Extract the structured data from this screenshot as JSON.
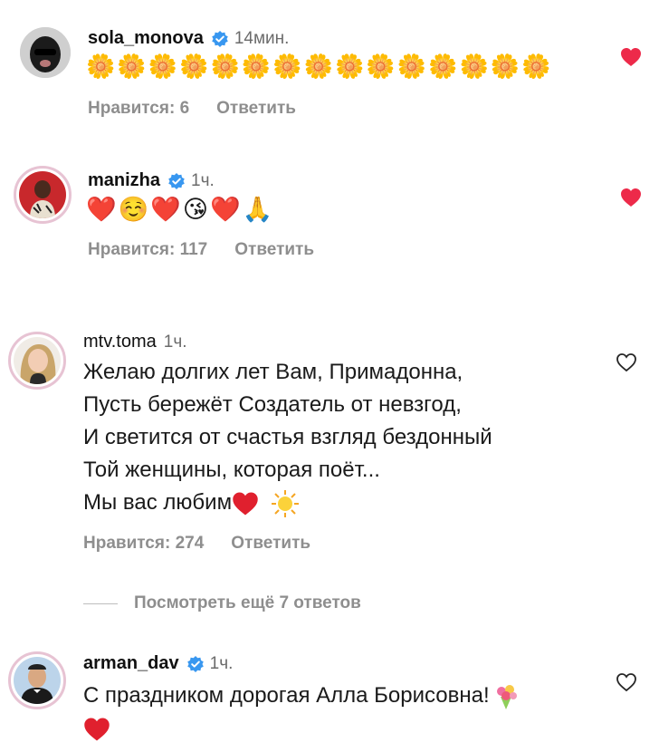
{
  "comments": [
    {
      "username": "sola_monova",
      "verified": true,
      "time": "14мин.",
      "emoji_text": "🌼🌼🌼🌼🌼🌼🌼🌼🌼🌼🌼🌼🌼🌼🌼",
      "likes_label": "Нравится: 6",
      "reply_label": "Ответить",
      "liked": true
    },
    {
      "username": "manizha",
      "verified": true,
      "time": "1ч.",
      "emoji_text": "❤️☺️❤️😘❤️🙏",
      "likes_label": "Нравится: 117",
      "reply_label": "Ответить",
      "liked": true
    },
    {
      "username": "mtv.toma",
      "verified": false,
      "time": "1ч.",
      "lines": [
        "Желаю долгих лет Вам, Примадонна,",
        "Пусть бережёт Создатель от невзгод,",
        "И светится от счастья взгляд бездонный",
        "Той женщины, которая поёт...",
        "Мы вас любим"
      ],
      "likes_label": "Нравится: 274",
      "reply_label": "Ответить",
      "liked": false
    },
    {
      "username": "arman_dav",
      "verified": true,
      "time": "1ч.",
      "lines": [
        "С праздником дорогая Алла Борисовна!"
      ],
      "liked": false
    }
  ],
  "view_more_label": "Посмотреть ещё 7 ответов",
  "colors": {
    "heart_red": "#ed2a4a",
    "verified_blue": "#3897f0",
    "muted": "#8e8e8e"
  }
}
